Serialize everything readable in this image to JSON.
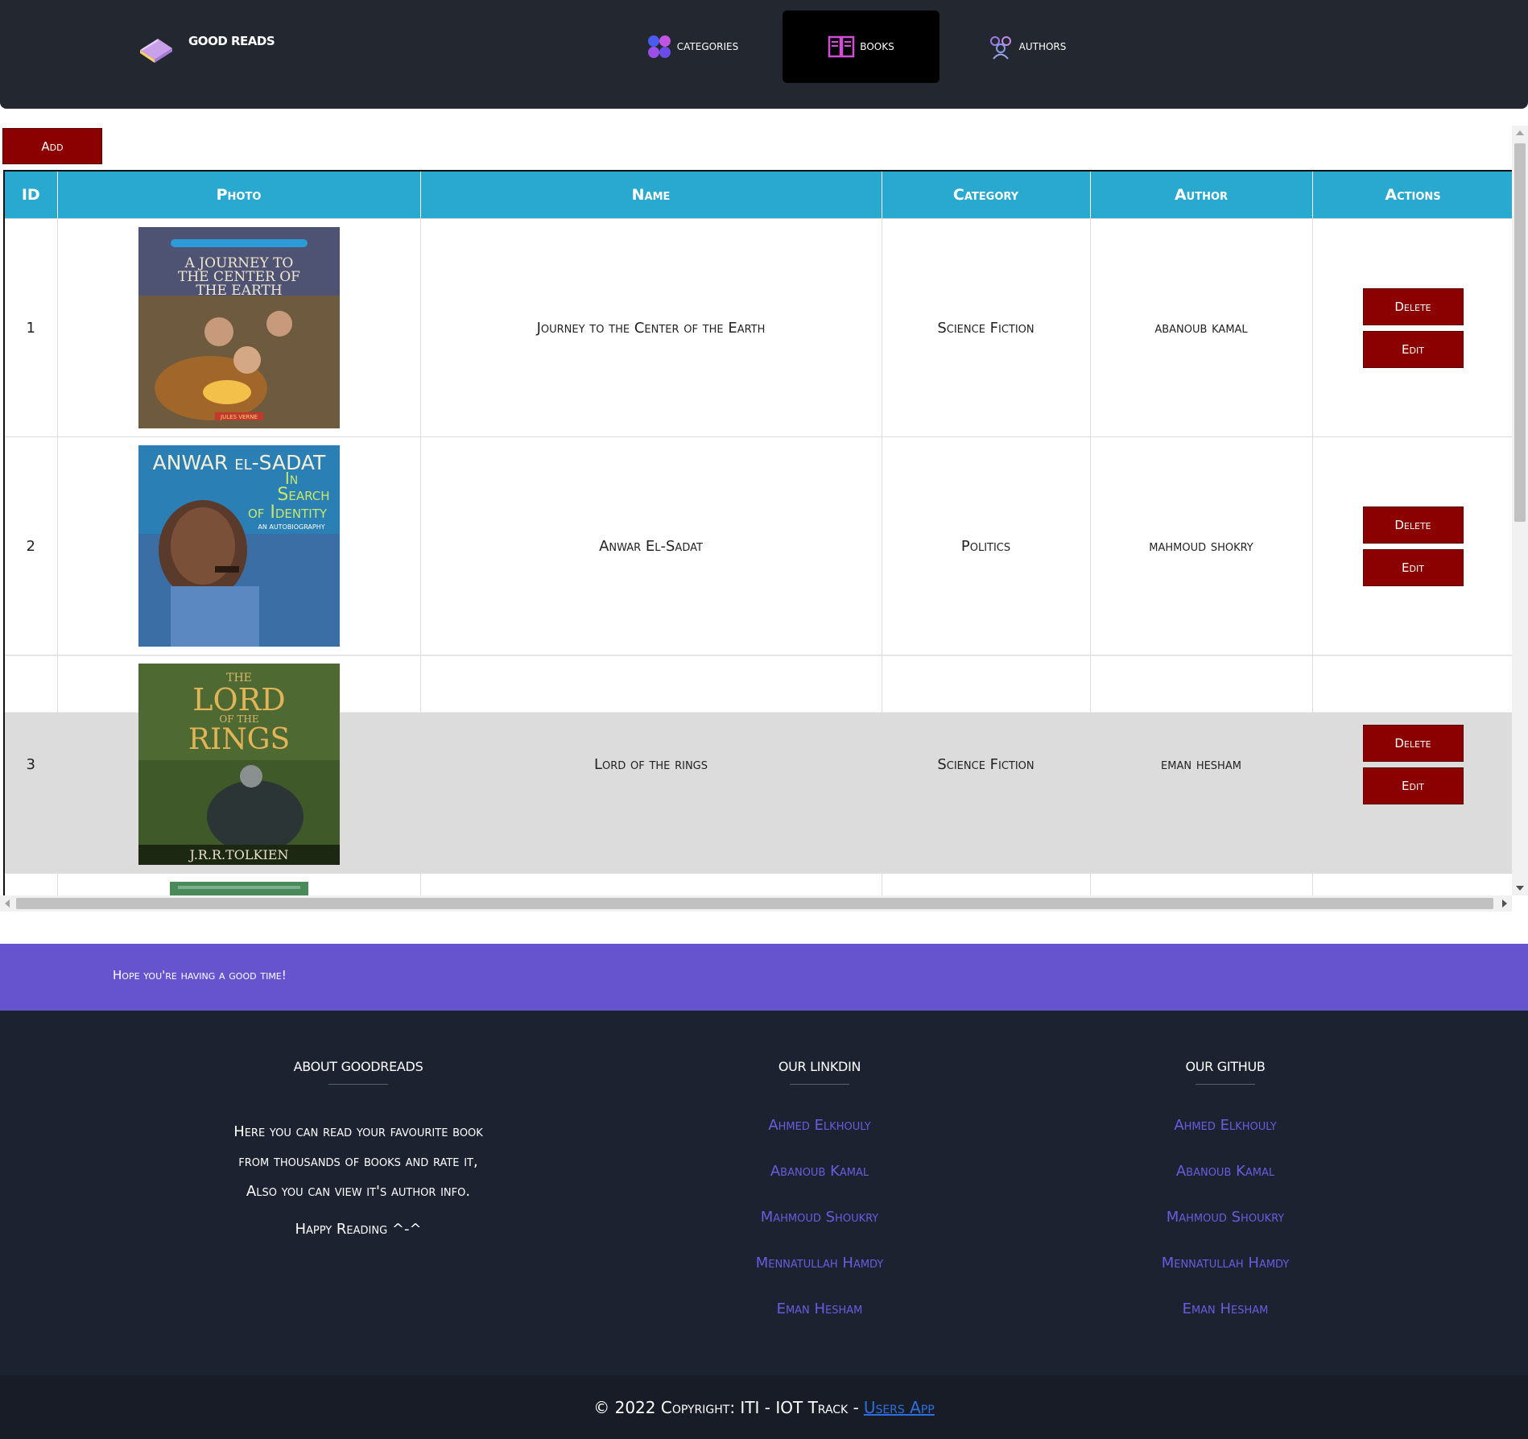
{
  "header": {
    "brand": "GOOD READS",
    "nav": [
      {
        "label": "Categories",
        "active": false
      },
      {
        "label": "Books",
        "active": true
      },
      {
        "label": "Authors",
        "active": false
      }
    ]
  },
  "main": {
    "add_label": "Add",
    "table": {
      "headers": [
        "ID",
        "Photo",
        "Name",
        "Category",
        "Author",
        "Actions"
      ],
      "rows": [
        {
          "id": "1",
          "cover_title": [
            "A JOURNEY TO",
            "THE CENTER OF",
            "THE EARTH"
          ],
          "cover_author": "JULES VERNE",
          "name": "Journey to the Center of the Earth",
          "category": "Science Fiction",
          "author": "abanoub kamal",
          "delete_label": "Delete",
          "edit_label": "Edit"
        },
        {
          "id": "2",
          "cover_title": [
            "ANWAR el-SADAT",
            "In",
            "Search",
            "of Identity"
          ],
          "cover_author": "AN AUTOBIOGRAPHY",
          "name": "Anwar El-Sadat",
          "category": "Politics",
          "author": "mahmoud shokry",
          "delete_label": "Delete",
          "edit_label": "Edit"
        },
        {
          "id": "3",
          "cover_title": [
            "THE",
            "LORD",
            "OF THE",
            "RINGS"
          ],
          "cover_author": "J.R.R.TOLKIEN",
          "name": "Lord of the rings",
          "category": "Science Fiction",
          "author": "eman hesham",
          "delete_label": "Delete",
          "edit_label": "Edit"
        }
      ]
    }
  },
  "banner": {
    "text": "Hope you're having a good time!"
  },
  "footer": {
    "about": {
      "heading": "ABOUT GOODREADS",
      "lines": [
        "Here you can read your favourite book",
        "from thousands of books and rate it,",
        "Also you can view it's author info."
      ],
      "closing": "Happy Reading ^-^"
    },
    "linkedin": {
      "heading": "OUR LINKDIN",
      "links": [
        "Ahmed Elkhouly",
        "Abanoub Kamal",
        "Mahmoud Shoukry",
        "Mennatullah Hamdy",
        "Eman Hesham"
      ]
    },
    "github": {
      "heading": "OUR GITHUB",
      "links": [
        "Ahmed Elkhouly",
        "Abanoub Kamal",
        "Mahmoud Shoukry",
        "Mennatullah Hamdy",
        "Eman Hesham"
      ]
    },
    "copyright": "© 2022 Copyright: ITI - IOT Track -",
    "copyright_link": "Users App"
  },
  "colors": {
    "header_bg": "#23272f",
    "table_header": "#29a9d0",
    "action_button": "#8b0000",
    "banner": "#6653ce",
    "footer_bg": "#1d2230",
    "footer_link": "#6a5ce0",
    "copyright_link": "#2e6fe0"
  },
  "icons": [
    "book-logo-icon",
    "categories-icon",
    "books-icon",
    "authors-icon"
  ]
}
